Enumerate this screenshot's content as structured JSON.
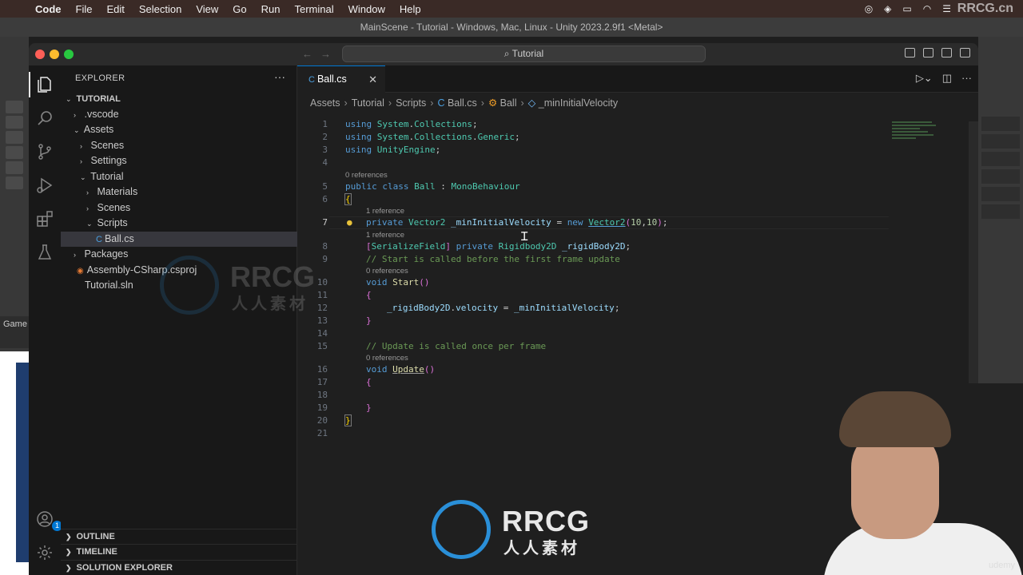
{
  "menubar": {
    "app": "Code",
    "items": [
      "File",
      "Edit",
      "Selection",
      "View",
      "Go",
      "Run",
      "Terminal",
      "Window",
      "Help"
    ],
    "watermark": "RRCG.cn"
  },
  "unity": {
    "title": "MainScene - Tutorial - Windows, Mac, Linux - Unity 2023.2.9f1 <Metal>",
    "game_tab": "Game"
  },
  "window": {
    "command_center": "Tutorial"
  },
  "explorer": {
    "header": "EXPLORER",
    "tree": [
      {
        "label": "TUTORIAL",
        "depth": 0,
        "chevron": "down",
        "root": true
      },
      {
        "label": ".vscode",
        "depth": 1,
        "chevron": "right"
      },
      {
        "label": "Assets",
        "depth": 1,
        "chevron": "down"
      },
      {
        "label": "Scenes",
        "depth": 2,
        "chevron": "right"
      },
      {
        "label": "Settings",
        "depth": 2,
        "chevron": "right"
      },
      {
        "label": "Tutorial",
        "depth": 2,
        "chevron": "down"
      },
      {
        "label": "Materials",
        "depth": 3,
        "chevron": "right"
      },
      {
        "label": "Scenes",
        "depth": 3,
        "chevron": "right"
      },
      {
        "label": "Scripts",
        "depth": 3,
        "chevron": "down"
      },
      {
        "label": "Ball.cs",
        "depth": 4,
        "icon": "csharp",
        "selected": true
      },
      {
        "label": "Packages",
        "depth": 1,
        "chevron": "right"
      },
      {
        "label": "Assembly-CSharp.csproj",
        "depth": 1,
        "icon": "rss"
      },
      {
        "label": "Tutorial.sln",
        "depth": 1
      }
    ],
    "sections": [
      "OUTLINE",
      "TIMELINE",
      "SOLUTION EXPLORER"
    ]
  },
  "activity": {
    "accounts_badge": "1"
  },
  "editor": {
    "tab_label": "Ball.cs",
    "breadcrumb": [
      "Assets",
      "Tutorial",
      "Scripts",
      "Ball.cs",
      "Ball",
      "_minInitialVelocity"
    ],
    "code_lens": {
      "line5": "0 references",
      "line7": "1 reference",
      "line8": "1 reference",
      "line10": "0 references",
      "line16": "0 references"
    },
    "line_numbers": [
      "1",
      "2",
      "3",
      "4",
      "5",
      "6",
      "7",
      "8",
      "9",
      "10",
      "11",
      "12",
      "13",
      "14",
      "15",
      "16",
      "17",
      "18",
      "19",
      "20",
      "21"
    ],
    "current_line": 7
  },
  "overlay": {
    "udemy": "udemy",
    "watermark_big": "RRCG",
    "watermark_small": "人人素材"
  },
  "colors": {
    "accent": "#0078d4",
    "keyword": "#569cd6",
    "type": "#4ec9b0",
    "comment": "#6a9955",
    "function": "#dcdcaa"
  }
}
